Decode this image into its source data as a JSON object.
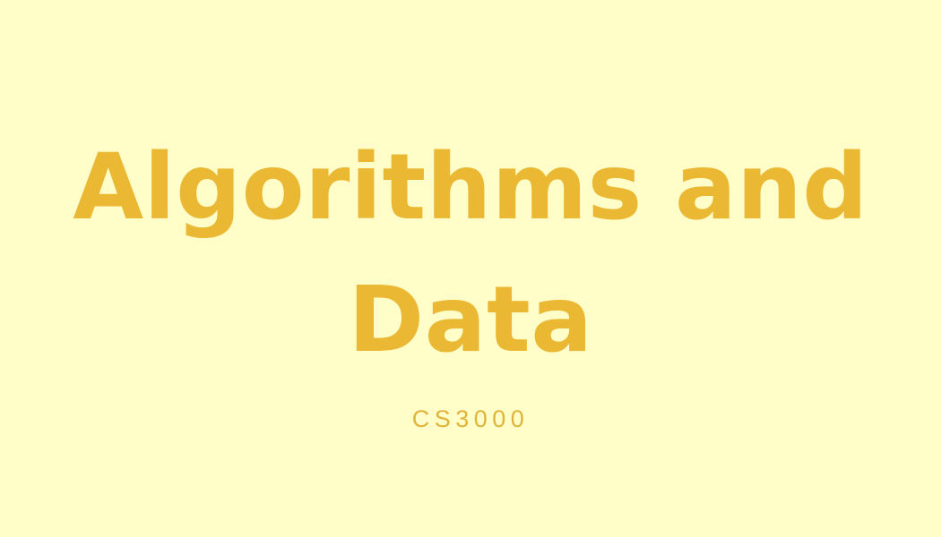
{
  "slide": {
    "title_line_1": "Algorithms and",
    "title_line_2": "Data",
    "subtitle": "CS3000"
  },
  "colors": {
    "background": "#fffdc8",
    "title": "#ebb834",
    "subtitle": "#e0b43a"
  }
}
